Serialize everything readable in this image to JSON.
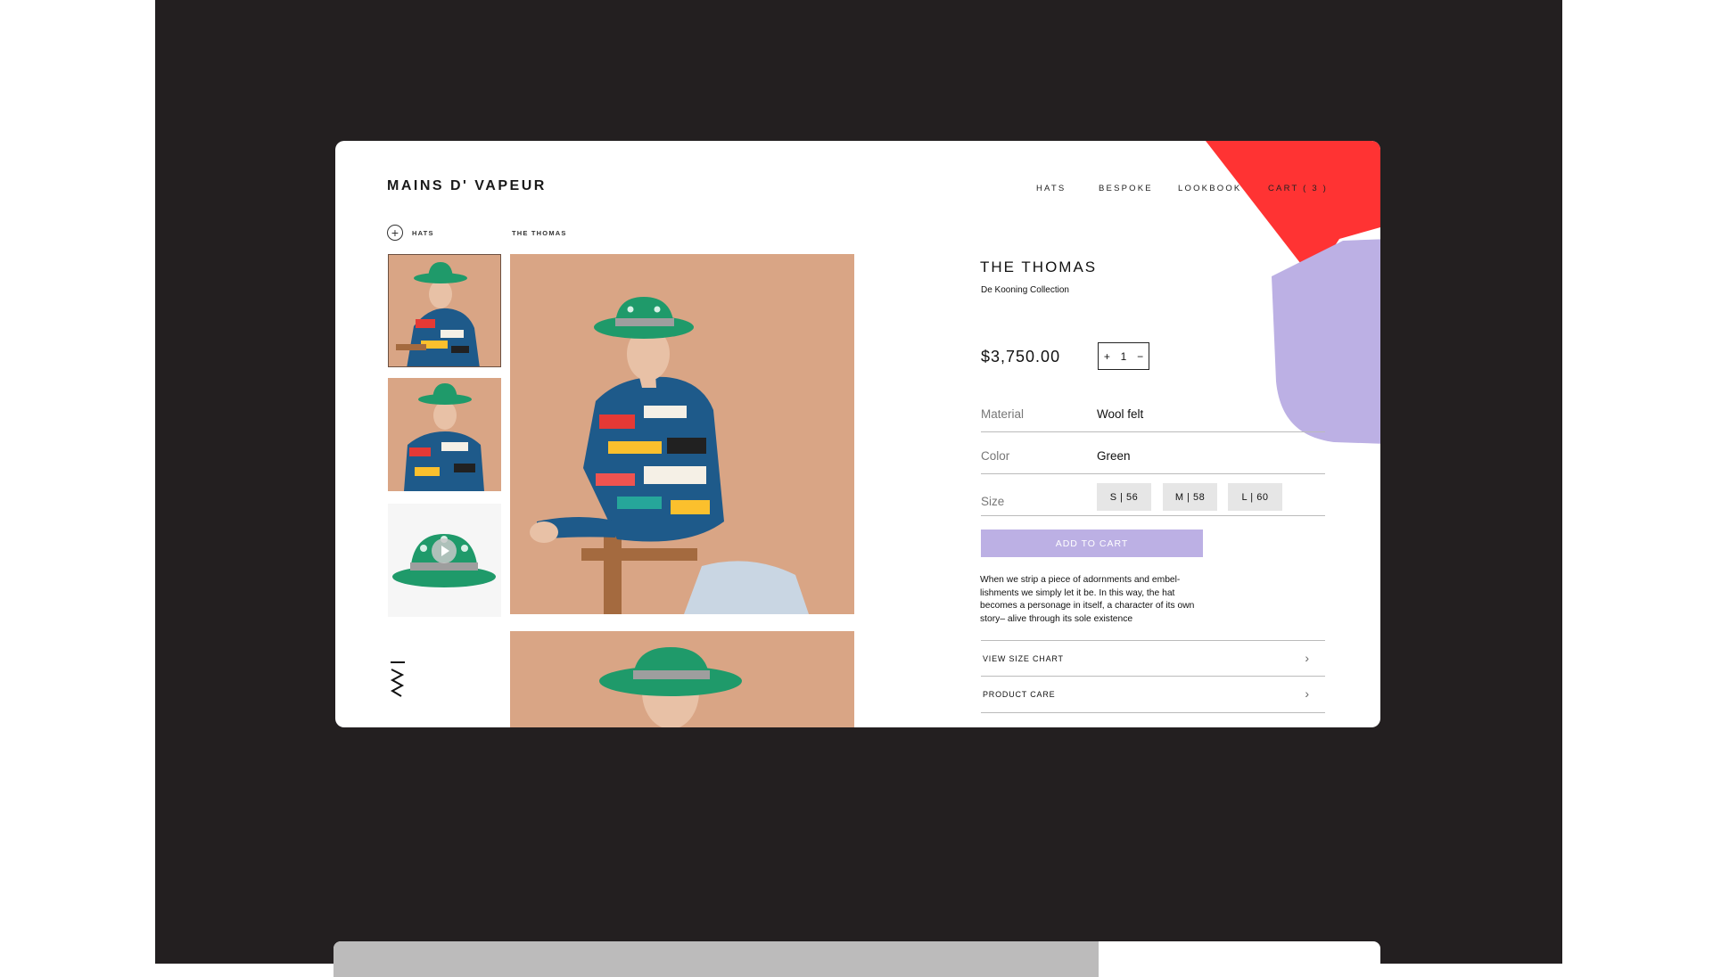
{
  "brand": {
    "logo": "MAINS D' VAPEUR"
  },
  "nav": {
    "hats": "HATS",
    "bespoke": "BESPOKE",
    "lookbook": "LOOKBOOK",
    "cart": "CART ( 3 )"
  },
  "breadcrumb": {
    "plus": "+",
    "category": "HATS",
    "current": "THE THOMAS"
  },
  "product": {
    "title": "THE THOMAS",
    "collection": "De Kooning Collection",
    "price": "$3,750.00",
    "quantity": {
      "plus": "+",
      "value": "1",
      "minus": "−"
    },
    "attributes": {
      "material_label": "Material",
      "material_value": "Wool felt",
      "color_label": "Color",
      "color_value": "Green",
      "size_label": "Size"
    },
    "sizes": [
      "S | 56",
      "M | 58",
      "L | 60"
    ],
    "add_to_cart": "ADD TO CART",
    "description": "When we strip a piece of adornments and embel-lishments we simply let it be. In this way, the hat becomes a personage in itself, a character of its own story– alive through its sole existence",
    "accordion": [
      {
        "label": "VIEW SIZE CHART",
        "chevron": "›"
      },
      {
        "label": "PRODUCT CARE",
        "chevron": "›"
      }
    ]
  },
  "colors": {
    "background_dark": "#231f20",
    "accent_red": "#ff3333",
    "accent_violet": "#bcb0e4",
    "hat_green": "#1f9a6a",
    "photo_backdrop": "#d9a585"
  },
  "icons": [
    "plus-circle-icon",
    "chevron-right-icon",
    "play-icon",
    "mw-monogram-icon"
  ]
}
